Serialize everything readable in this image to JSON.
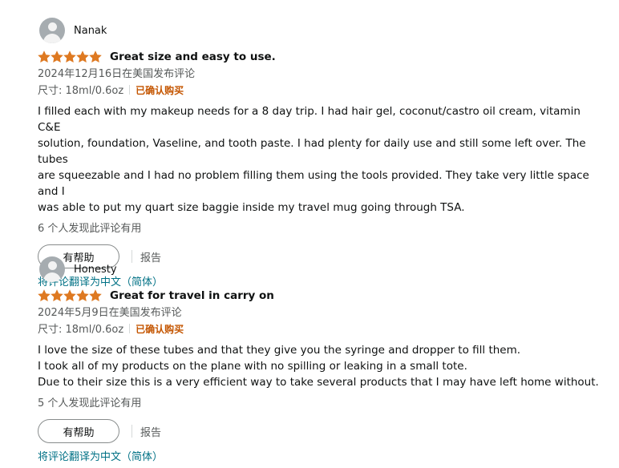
{
  "colors": {
    "star": "#de7921",
    "verified": "#c45500",
    "link": "#007185",
    "muted": "#565959",
    "text": "#0f1111"
  },
  "reviews": [
    {
      "reviewer": "Nanak",
      "rating": 5,
      "title": "Great size and easy to use.",
      "date": "2024年12月16日在美国发布评论",
      "size": "尺寸: 18ml/0.6oz",
      "verified": "已确认购买",
      "body": [
        "I filled each with my makeup needs for a 8 day trip. I had hair gel, coconut/castro oil cream, vitamin C&E",
        "solution, foundation, Vaseline, and tooth paste. I had plenty for daily use and still some left over. The tubes",
        "are squeezable and I had no problem filling them using the tools provided. They take very little space and I",
        "was able to put my quart size baggie inside my travel mug going through TSA."
      ],
      "helpful_count": "6 个人发现此评论有用",
      "helpful_button": "有帮助",
      "report": "报告",
      "translate": "将评论翻译为中文（简体）"
    },
    {
      "reviewer": "Honesty",
      "rating": 5,
      "title": "Great for travel in carry on",
      "date": "2024年5月9日在美国发布评论",
      "size": "尺寸: 18ml/0.6oz",
      "verified": "已确认购买",
      "body": [
        "I love the size of these tubes and that they give you the syringe and dropper to fill them.",
        "I took all of my products on the plane with no spilling or leaking in a small tote.",
        "Due to their size this is a very efficient way to take several products that I may have left home without."
      ],
      "helpful_count": "5 个人发现此评论有用",
      "helpful_button": "有帮助",
      "report": "报告",
      "translate": "将评论翻译为中文（简体）"
    }
  ]
}
